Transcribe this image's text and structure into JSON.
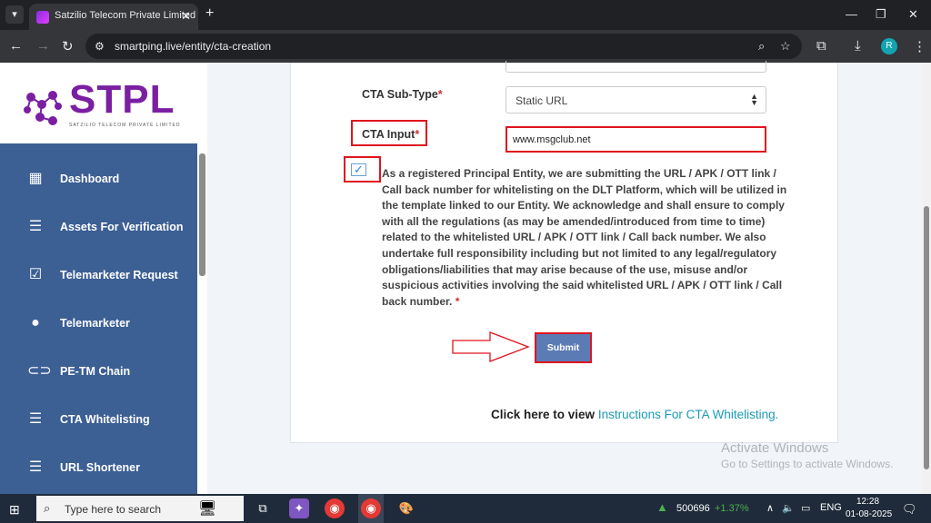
{
  "browser": {
    "tab_title": "Satzilio Telecom Private Limited",
    "url": "smartping.live/entity/cta-creation",
    "profile_initial": "R"
  },
  "logo": {
    "text": "STPL",
    "subtitle": "SATZILIO TELECOM PRIVATE LIMITED"
  },
  "sidebar": {
    "items": [
      {
        "label": "Dashboard",
        "icon": "dashboard-icon"
      },
      {
        "label": "Assets For Verification",
        "icon": "list-icon"
      },
      {
        "label": "Telemarketer Request",
        "icon": "clipboard-check-icon"
      },
      {
        "label": "Telemarketer",
        "icon": "person-icon"
      },
      {
        "label": "PE-TM Chain",
        "icon": "link-icon"
      },
      {
        "label": "CTA Whitelisting",
        "icon": "list-icon"
      },
      {
        "label": "URL Shortener",
        "icon": "list-icon"
      }
    ]
  },
  "form": {
    "subtype_label": "CTA Sub-Type",
    "subtype_value": "Static URL",
    "input_label": "CTA Input",
    "input_value": "www.msgclub.net",
    "required_mark": "*",
    "consent_text": "As a registered Principal Entity, we are submitting the URL / APK / OTT link / Call back number for whitelisting on the DLT Platform, which will be utilized in the template linked to our Entity. We acknowledge and shall ensure to comply with all the regulations (as may be amended/introduced from time to time) related to the whitelisted URL / APK / OTT link / Call back number. We also undertake full responsibility including but not limited to any legal/regulatory obligations/liabilities that may arise because of the use, misuse and/or suspicious activities involving the said whitelisted URL / APK / OTT link / Call back number.",
    "consent_checked": true,
    "submit_label": "Submit",
    "instructions_prefix": "Click here to view",
    "instructions_link": "Instructions For CTA Whitelisting."
  },
  "watermark": {
    "line1": "Activate Windows",
    "line2": "Go to Settings to activate Windows."
  },
  "taskbar": {
    "search_placeholder": "Type here to search",
    "stock_value": "500696",
    "stock_change": "+1.37%",
    "language": "ENG",
    "time": "12:28",
    "date": "01-08-2025"
  },
  "colors": {
    "sidebar_bg": "#3c5f94",
    "highlight": "#e0141e",
    "submit_bg": "#5b7bb5",
    "link": "#1a9bb5"
  }
}
